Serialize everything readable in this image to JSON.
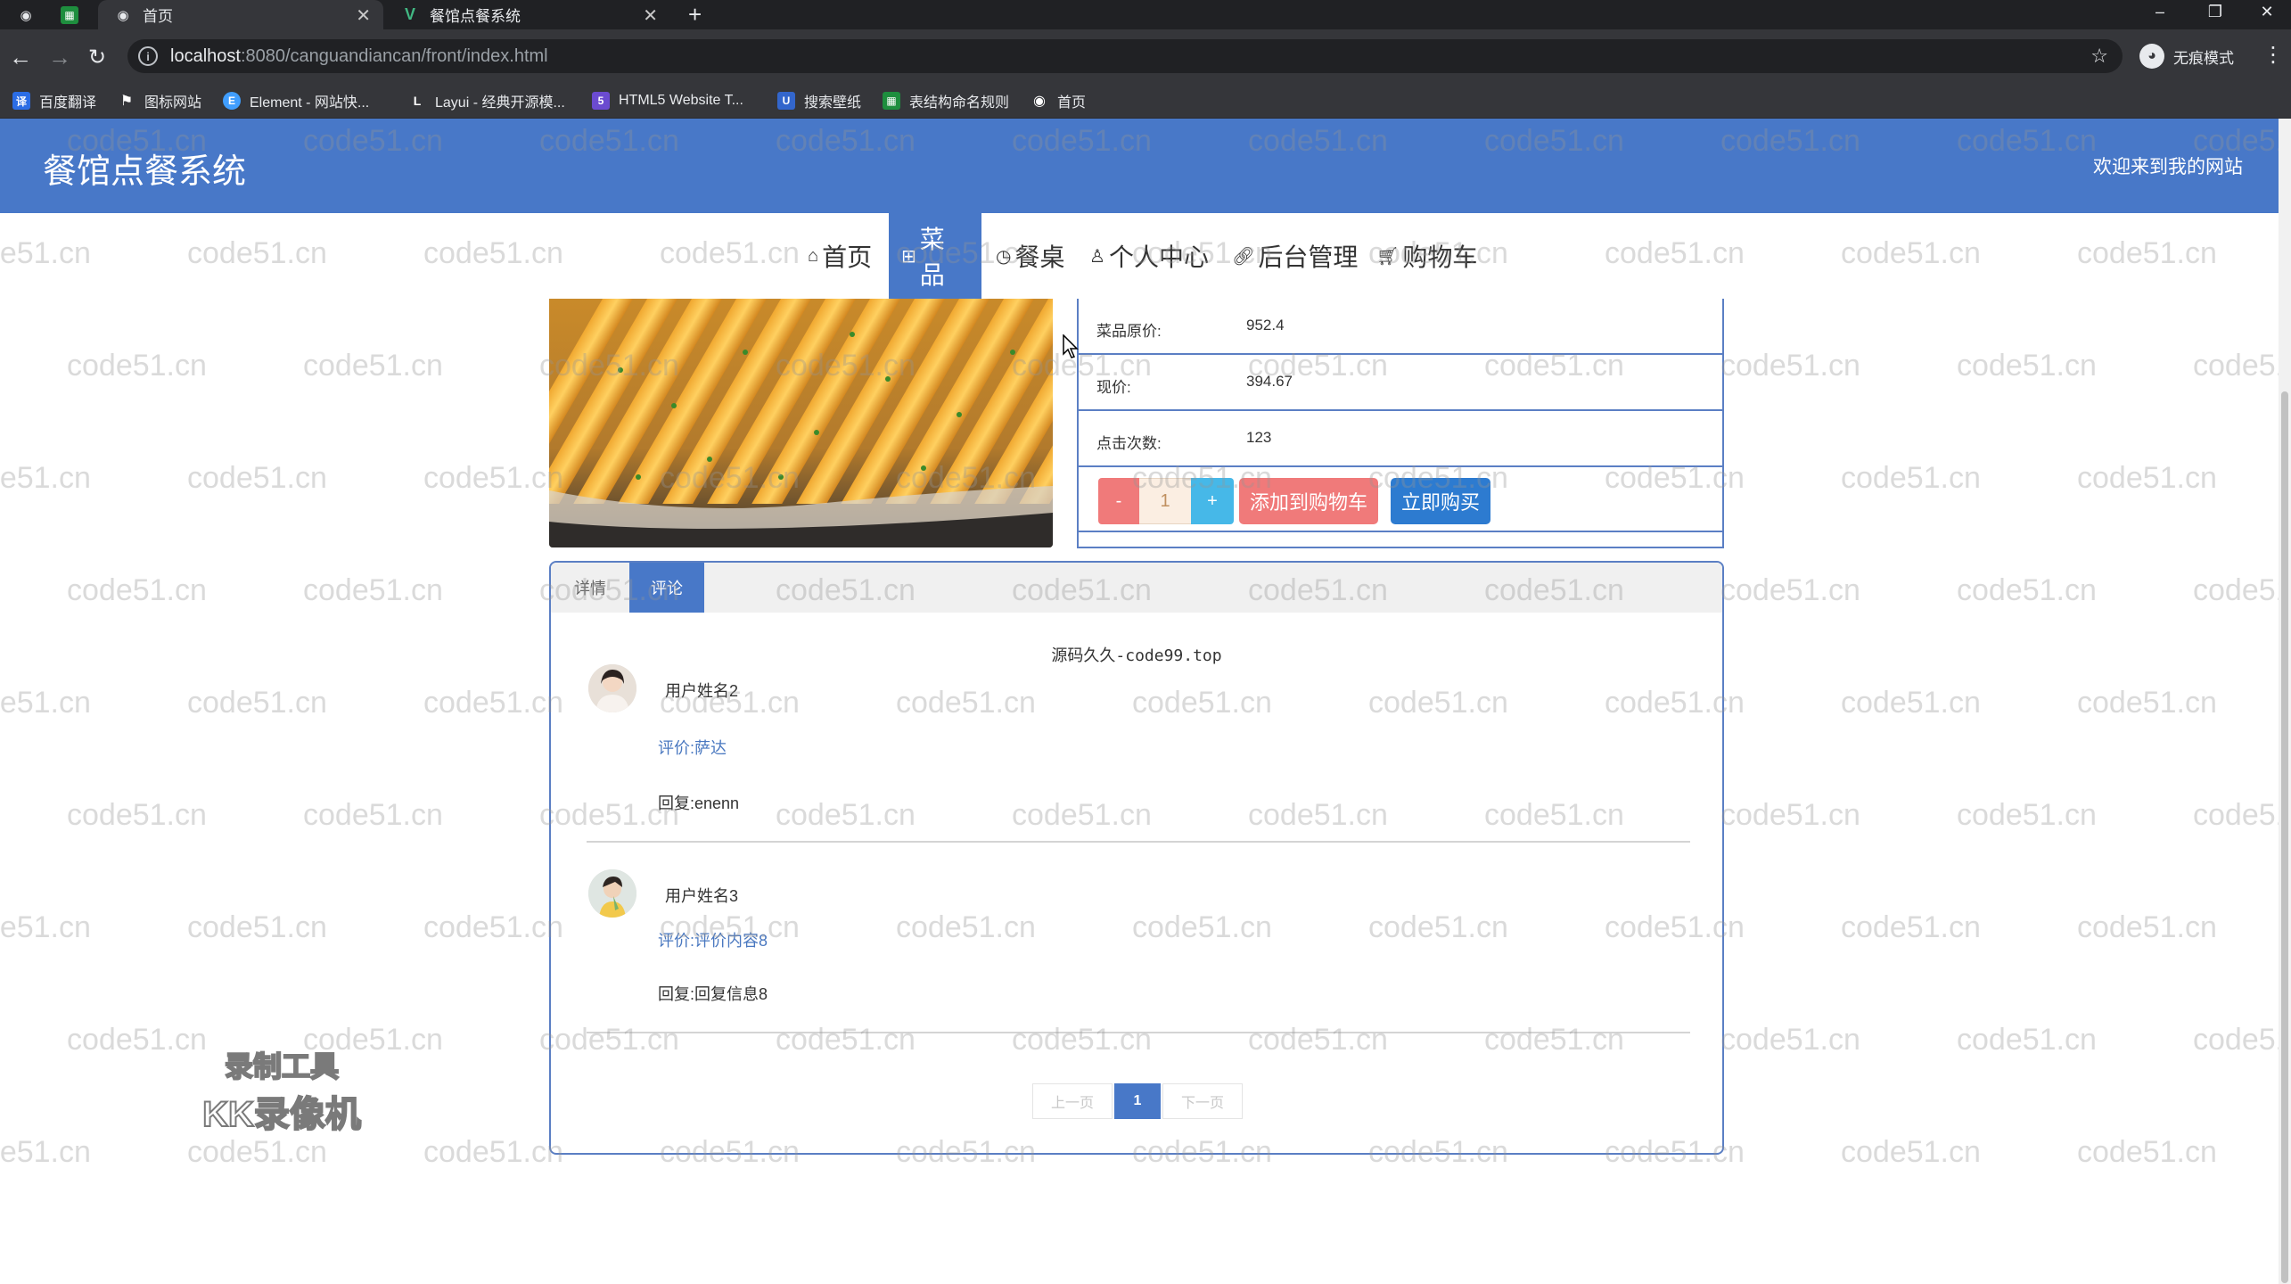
{
  "browser": {
    "tabs": [
      {
        "label": "首页",
        "icon": "globe-icon"
      },
      {
        "label": "餐馆点餐系统",
        "icon": "vue-icon"
      }
    ],
    "new_tab_symbol": "+",
    "url_host": "localhost",
    "url_path": ":8080/canguandiancan/front/index.html",
    "incognito_label": "无痕模式",
    "bookmarks": [
      {
        "label": "百度翻译",
        "icon": "baidu-translate-icon",
        "color": "#2b6de5"
      },
      {
        "label": "图标网站",
        "icon": "flag-icon",
        "color": "#35363a"
      },
      {
        "label": "Element - 网站快...",
        "icon": "element-icon",
        "color": "#409eff"
      },
      {
        "label": "Layui - 经典开源模...",
        "icon": "layui-icon",
        "color": "#35363a"
      },
      {
        "label": "HTML5 Website T...",
        "icon": "html5-template-icon",
        "color": "#6b4bd0"
      },
      {
        "label": "搜索壁纸",
        "icon": "wallpaper-icon",
        "color": "#3366cc"
      },
      {
        "label": "表结构命名规则",
        "icon": "sheet-icon",
        "color": "#1e8e3e"
      },
      {
        "label": "首页",
        "icon": "globe-icon",
        "color": "#35363a"
      }
    ]
  },
  "site": {
    "title": "餐馆点餐系统",
    "welcome": "欢迎来到我的网站",
    "brand_color": "#4878c8",
    "nav": [
      {
        "label": "首页",
        "icon": "home-icon",
        "active": false
      },
      {
        "label": "菜品",
        "icon": "grid-icon",
        "active": true
      },
      {
        "label": "餐桌",
        "icon": "clock-icon",
        "active": false
      },
      {
        "label": "个人中心",
        "icon": "user-icon",
        "active": false
      },
      {
        "label": "后台管理",
        "icon": "link-icon",
        "active": false
      },
      {
        "label": "购物车",
        "icon": "cart-icon",
        "active": false
      }
    ]
  },
  "dish": {
    "rows": [
      {
        "key": "菜品原价:",
        "value": "952.4"
      },
      {
        "key": "现价:",
        "value": "394.67"
      },
      {
        "key": "点击次数:",
        "value": "123"
      }
    ],
    "qty_minus": "-",
    "qty_value": "1",
    "qty_plus": "+",
    "add_to_cart": "添加到购物车",
    "buy_now": "立即购买"
  },
  "detail_tabs": [
    {
      "label": "详情",
      "active": false
    },
    {
      "label": "评论",
      "active": true
    }
  ],
  "comments_watermark": "源码久久-code99.top",
  "comments": [
    {
      "user": "用户姓名2",
      "evaluation": "评价:萨达",
      "reply": "回复:enenn"
    },
    {
      "user": "用户姓名3",
      "evaluation": "评价:评价内容8",
      "reply": "回复:回复信息8"
    }
  ],
  "pagination": {
    "prev": "上一页",
    "current": "1",
    "next": "下一页"
  },
  "overlay": {
    "watermark": "code51.cn",
    "recorder_line1": "录制工具",
    "recorder_line2": "KK录像机"
  }
}
